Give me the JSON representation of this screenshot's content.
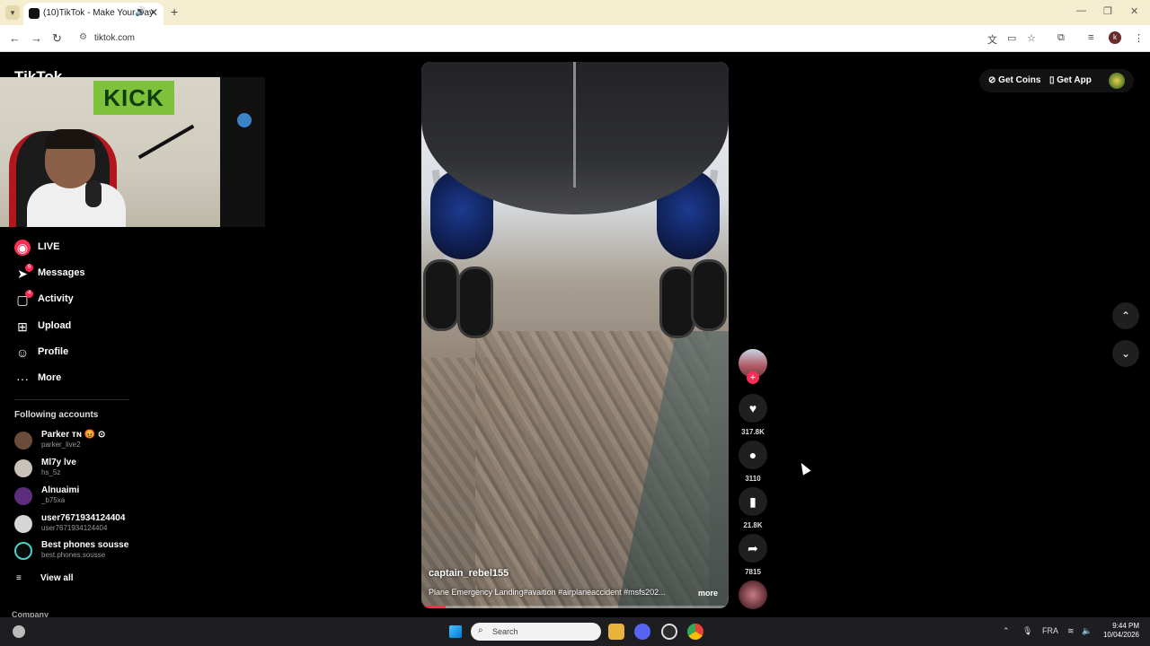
{
  "browser": {
    "tab_title": "(10)TikTok - Make Your Day",
    "url": "tiktok.com"
  },
  "site": {
    "logo": "TikTok"
  },
  "webcam": {
    "sign_text": "KICK"
  },
  "nav": {
    "items": [
      {
        "label": "LIVE",
        "icon": "live-icon",
        "badge": ""
      },
      {
        "label": "Messages",
        "icon": "messages-icon",
        "badge": "6"
      },
      {
        "label": "Activity",
        "icon": "activity-icon",
        "badge": "4"
      },
      {
        "label": "Upload",
        "icon": "upload-icon",
        "badge": ""
      },
      {
        "label": "Profile",
        "icon": "profile-icon",
        "badge": ""
      },
      {
        "label": "More",
        "icon": "more-icon",
        "badge": ""
      }
    ]
  },
  "following": {
    "title": "Following accounts",
    "accounts": [
      {
        "name": "Parker ᴛɴ 😡 ⊙",
        "username": "parker_live2",
        "color": "#6b4c3a"
      },
      {
        "name": "Ml7y lve",
        "username": "hs_5z",
        "color": "#c9c2b8"
      },
      {
        "name": "Alnuaimi",
        "username": "_b75xa",
        "color": "#5b2d7a"
      },
      {
        "name": "user7671934124404",
        "username": "user7671934124404",
        "color": "#d6d6d6"
      },
      {
        "name": "Best phones sousse",
        "username": "best.phones.sousse",
        "color": "#0a0a0a"
      }
    ],
    "view_all": "View all"
  },
  "footer": {
    "company": "Company"
  },
  "video": {
    "author": "captain_rebel155",
    "description": "Plane Emergency Landing#avaition #airplaneaccident #msfs202...",
    "more_label": "more",
    "progress": 0.08
  },
  "actions": {
    "likes": "317.8K",
    "comments": "3110",
    "saves": "21.8K",
    "shares": "7815"
  },
  "header_actions": {
    "get_coins": "Get Coins",
    "get_app": "Get App"
  },
  "taskbar": {
    "search_placeholder": "Search",
    "language": "FRA",
    "time": "9:44 PM",
    "date": "10/04/2026"
  },
  "colors": {
    "accent": "#fe2c55",
    "chrome_tabbar": "#f4edcf",
    "page_bg": "#000000"
  }
}
